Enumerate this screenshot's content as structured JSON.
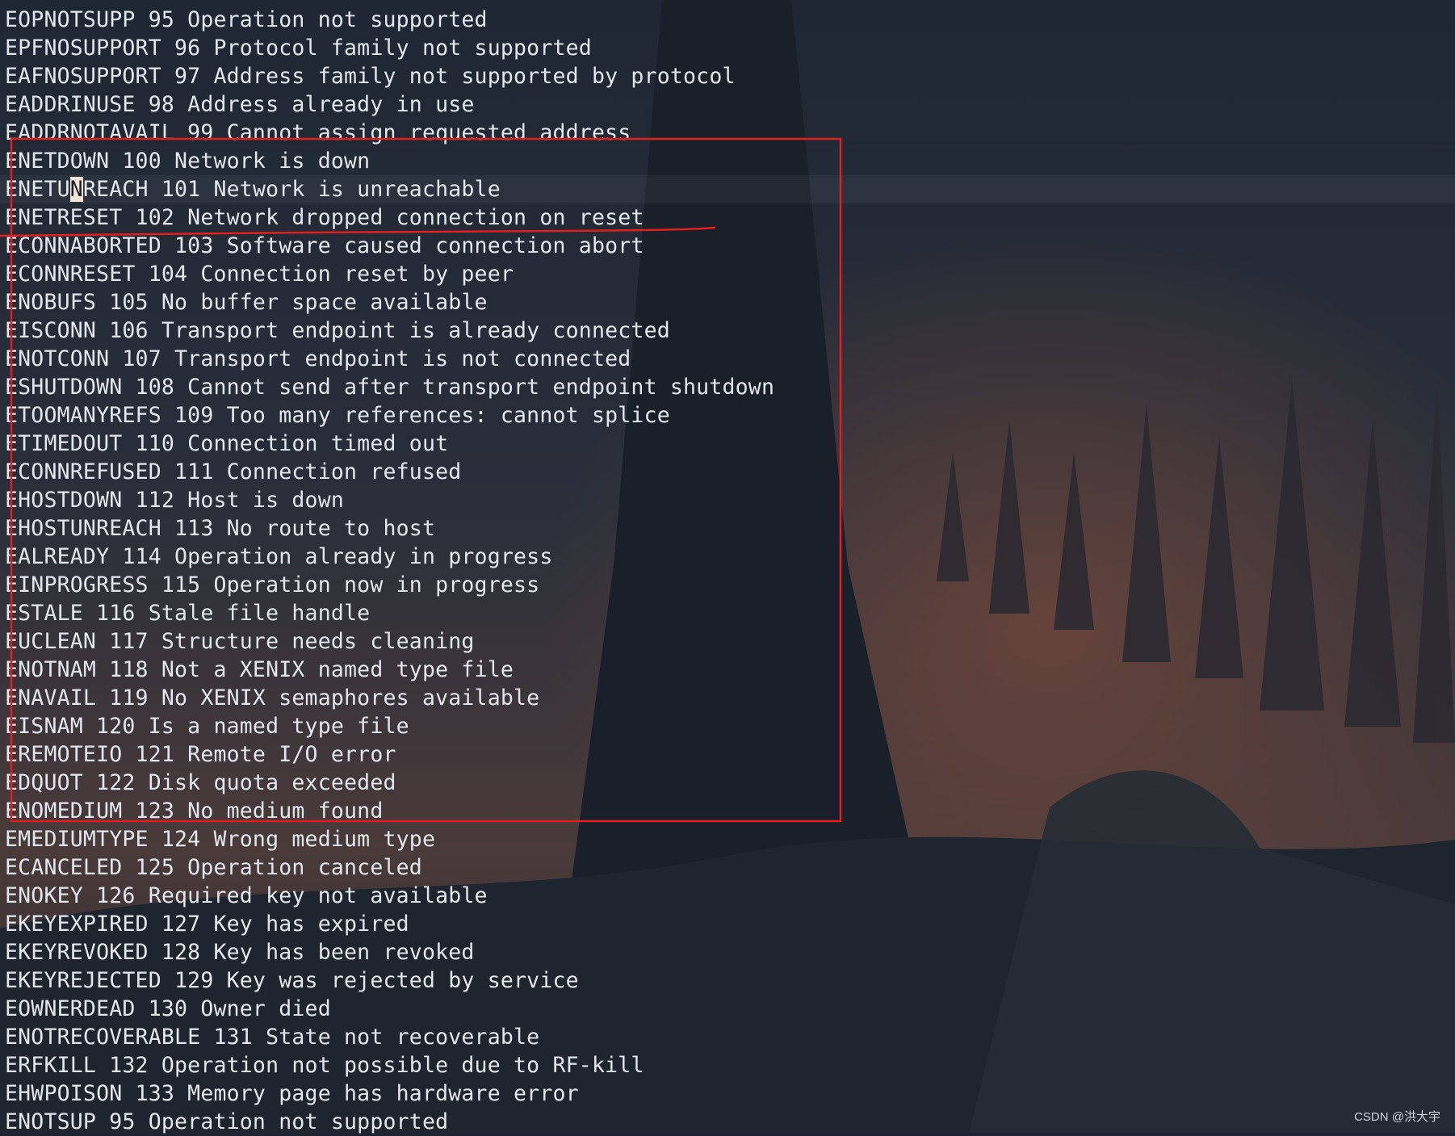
{
  "terminal": {
    "lines": [
      "EOPNOTSUPP 95 Operation not supported",
      "EPFNOSUPPORT 96 Protocol family not supported",
      "EAFNOSUPPORT 97 Address family not supported by protocol",
      "EADDRINUSE 98 Address already in use",
      "EADDRNOTAVAIL 99 Cannot assign requested address",
      "ENETDOWN 100 Network is down",
      "ENETUNREACH 101 Network is unreachable",
      "ENETRESET 102 Network dropped connection on reset",
      "ECONNABORTED 103 Software caused connection abort",
      "ECONNRESET 104 Connection reset by peer",
      "ENOBUFS 105 No buffer space available",
      "EISCONN 106 Transport endpoint is already connected",
      "ENOTCONN 107 Transport endpoint is not connected",
      "ESHUTDOWN 108 Cannot send after transport endpoint shutdown",
      "ETOOMANYREFS 109 Too many references: cannot splice",
      "ETIMEDOUT 110 Connection timed out",
      "ECONNREFUSED 111 Connection refused",
      "EHOSTDOWN 112 Host is down",
      "EHOSTUNREACH 113 No route to host",
      "EALREADY 114 Operation already in progress",
      "EINPROGRESS 115 Operation now in progress",
      "ESTALE 116 Stale file handle",
      "EUCLEAN 117 Structure needs cleaning",
      "ENOTNAM 118 Not a XENIX named type file",
      "ENAVAIL 119 No XENIX semaphores available",
      "EISNAM 120 Is a named type file",
      "EREMOTEIO 121 Remote I/O error",
      "EDQUOT 122 Disk quota exceeded",
      "ENOMEDIUM 123 No medium found",
      "EMEDIUMTYPE 124 Wrong medium type",
      "ECANCELED 125 Operation canceled",
      "ENOKEY 126 Required key not available",
      "EKEYEXPIRED 127 Key has expired",
      "EKEYREVOKED 128 Key has been revoked",
      "EKEYREJECTED 129 Key was rejected by service",
      "EOWNERDEAD 130 Owner died",
      "ENOTRECOVERABLE 131 State not recoverable",
      "ERFKILL 132 Operation not possible due to RF-kill",
      "EHWPOISON 133 Memory page has hardware error",
      "ENOTSUP 95 Operation not supported"
    ],
    "cursor": {
      "line_index": 6,
      "before": "ENETU",
      "char": "N",
      "after": "REACH 101 Network is unreachable"
    }
  },
  "watermark": "CSDN @洪大宇",
  "colors": {
    "text": "#e3e7ee",
    "annotation_red": "#e02020",
    "cursor_block": "#f3e6d6"
  }
}
